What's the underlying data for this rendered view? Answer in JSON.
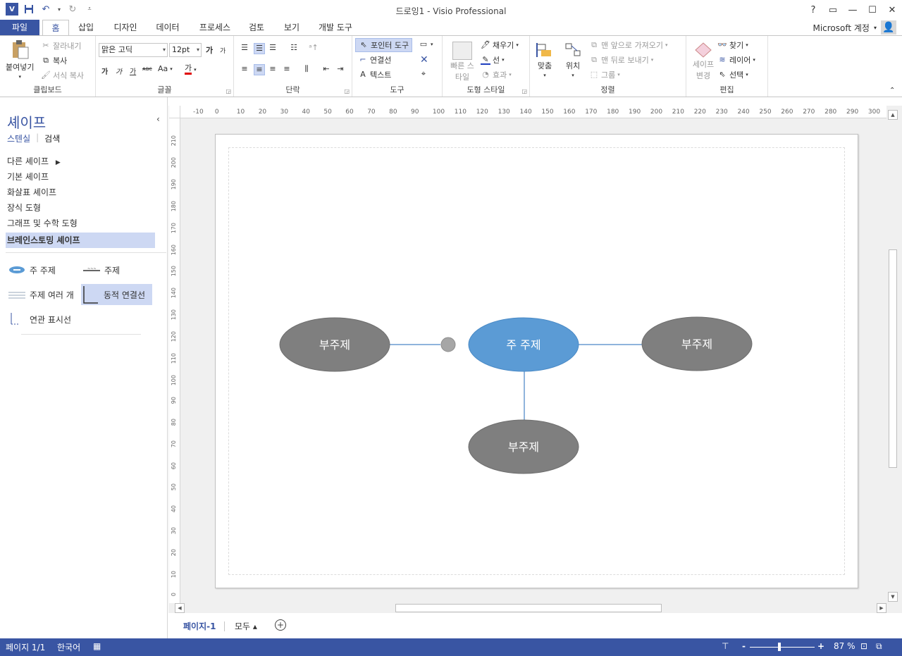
{
  "window": {
    "title": "드로잉1 - Visio Professional",
    "logo": "V",
    "help": "?",
    "restore": "▭",
    "minimize": "—",
    "maximize": "☐",
    "close": "✕"
  },
  "account": {
    "label": "Microsoft 계정"
  },
  "tabs": [
    {
      "label": "파일"
    },
    {
      "label": "홈"
    },
    {
      "label": "삽입"
    },
    {
      "label": "디자인"
    },
    {
      "label": "데이터"
    },
    {
      "label": "프로세스"
    },
    {
      "label": "검토"
    },
    {
      "label": "보기"
    },
    {
      "label": "개발 도구"
    }
  ],
  "ribbon": {
    "clipboard": {
      "label": "클립보드",
      "paste": "붙여넣기",
      "cut": "잘라내기",
      "copy": "복사",
      "format_painter": "서식 복사"
    },
    "font": {
      "label": "글꼴",
      "font_name": "맑은 고딕",
      "font_size": "12pt",
      "bold": "가",
      "italic": "가",
      "underline": "가",
      "strike": "ᴀʙᴄ",
      "case": "Aa",
      "color": "가",
      "grow": "가",
      "shrink": "가"
    },
    "paragraph": {
      "label": "단락"
    },
    "tools": {
      "label": "도구",
      "pointer": "포인터 도구",
      "connector": "연결선",
      "text": "텍스트"
    },
    "shape_styles": {
      "label": "도형 스타일",
      "quick_styles": "빠른 스타일",
      "fill": "채우기",
      "line": "선",
      "effects": "효과"
    },
    "arrange": {
      "label": "정렬",
      "align": "맞춤",
      "position": "위치",
      "bring_front": "맨 앞으로 가져오기",
      "send_back": "맨 뒤로 보내기",
      "group": "그룹"
    },
    "editing": {
      "label": "편집",
      "change_shape": "세이프 변경",
      "find": "찾기",
      "layers": "레이어",
      "select": "선택"
    }
  },
  "shapes_pane": {
    "title": "셰이프",
    "tab_stencil": "스텐실",
    "tab_search": "검색",
    "stencils": [
      {
        "label": "다른 셰이프"
      },
      {
        "label": "기본 셰이프"
      },
      {
        "label": "화살표 셰이프"
      },
      {
        "label": "장식 도형"
      },
      {
        "label": "그래프 및 수학 도형"
      },
      {
        "label": "브레인스토밍 셰이프"
      }
    ],
    "masters": [
      {
        "label": "주 주제"
      },
      {
        "label": "주제"
      },
      {
        "label": "주제 여러 개"
      },
      {
        "label": "동적 연결선"
      },
      {
        "label": "연관 표시선"
      }
    ]
  },
  "diagram": {
    "main": {
      "label": "주 주제",
      "color": "#5b9bd5"
    },
    "left": {
      "label": "부주제",
      "color": "#7f7f7f"
    },
    "right": {
      "label": "부주제",
      "color": "#7f7f7f"
    },
    "bottom": {
      "label": "부주제",
      "color": "#7f7f7f"
    },
    "connector_color": "#6a9bd1"
  },
  "rulers": {
    "h": [
      "-10",
      "0",
      "10",
      "20",
      "30",
      "40",
      "50",
      "60",
      "70",
      "80",
      "90",
      "100",
      "110",
      "120",
      "130",
      "140",
      "150",
      "160",
      "170",
      "180",
      "190",
      "200",
      "210",
      "220",
      "230",
      "240",
      "250",
      "260",
      "270",
      "280",
      "290",
      "300"
    ],
    "v": [
      "210",
      "200",
      "190",
      "180",
      "170",
      "160",
      "150",
      "140",
      "130",
      "120",
      "110",
      "100",
      "90",
      "80",
      "70",
      "60",
      "50",
      "40",
      "30",
      "20",
      "10",
      "0"
    ]
  },
  "page_tabs": {
    "page1": "페이지-1",
    "all": "모두 ▴",
    "add": "+"
  },
  "status": {
    "page": "페이지 1/1",
    "language": "한국어",
    "zoom": "87 %",
    "zoom_out": "-",
    "zoom_in": "+"
  },
  "colors": {
    "accent": "#3955a3",
    "selected": "#cdd8f3"
  }
}
